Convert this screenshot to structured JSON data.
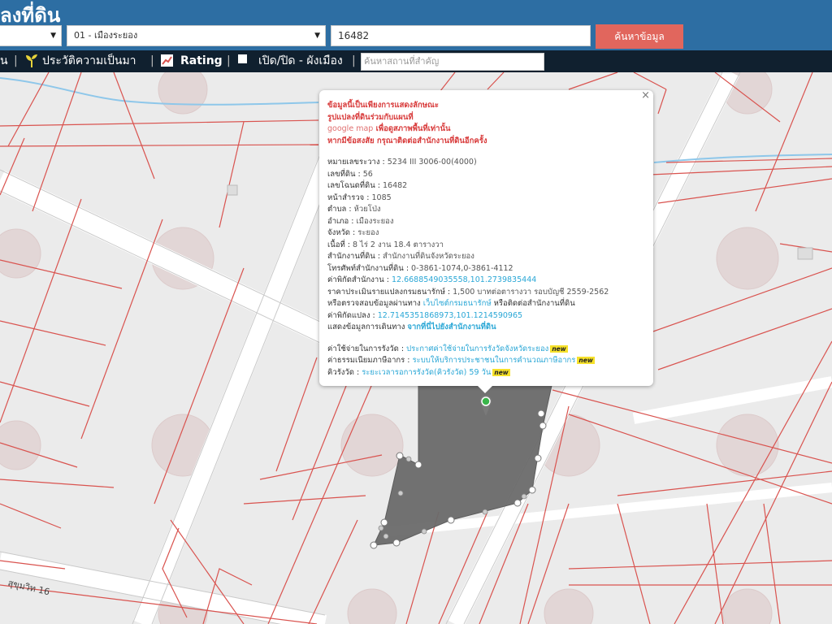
{
  "header": {
    "title": "ลงที่ดิน",
    "province_value": "",
    "district_value": "01 - เมืองระยอง",
    "deed_value": "16482",
    "search_button": "ค้นหาข้อมูล"
  },
  "toolbar": {
    "item1": "น",
    "history_label": "ประวัติความเป็นมา",
    "rating_label": "Rating",
    "toggle_label": "เปิด/ปิด - ผังเมือง",
    "place_search_placeholder": "ค้นหาสถานที่สำคัญ",
    "separator": "|"
  },
  "map": {
    "road_label": "สุขุมวิท 16",
    "parcel_color": "#6b6b6b",
    "boundary_color": "#d9534f"
  },
  "popup": {
    "close": "×",
    "disclaimer1": "ข้อมูลนี้เป็นเพียงการแสดงลักษณะ",
    "disclaimer2": "รูปแปลงที่ดินร่วมกับแผนที่",
    "disclaimer3_gm": "google map",
    "disclaimer3_rest": " เพื่อดูสภาพพื้นที่เท่านั้น",
    "disclaimer4": "หากมีข้อสงสัย กรุณาติดต่อสำนักงานที่ดินอีกครั้ง",
    "rows": [
      {
        "label": "หมายเลขระวาง",
        "value": "5234 III 3006-00(4000)"
      },
      {
        "label": "เลขที่ดิน",
        "value": "56"
      },
      {
        "label": "เลขโฉนดที่ดิน",
        "value": "16482"
      },
      {
        "label": "หน้าสำรวจ",
        "value": "1085"
      },
      {
        "label": "ตำบล",
        "value": "ห้วยโป่ง"
      },
      {
        "label": "อำเภอ",
        "value": "เมืองระยอง"
      },
      {
        "label": "จังหวัด",
        "value": "ระยอง"
      },
      {
        "label": "เนื้อที่",
        "value": "8 ไร่ 2 งาน 18.4 ตารางวา"
      },
      {
        "label": "สำนักงานที่ดิน",
        "value": "สำนักงานที่ดินจังหวัดระยอง"
      },
      {
        "label": "โทรศัพท์สำนักงานที่ดิน",
        "value": "0-3861-1074,0-3861-4112"
      }
    ],
    "office_coord_label": "ค่าพิกัดสำนักงาน",
    "office_coord_value": "12.6688549035558,101.2739835444",
    "price_label": "ราคาประเมินรายแปลงกรมธนารักษ์",
    "price_value": "1,500 บาทต่อตารางวา รอบบัญชี 2559-2562",
    "verify_text": "หรือตรวจสอบข้อมูลผ่านทาง",
    "verify_link": "เว็บไซต์กรมธนารักษ์",
    "verify_suffix": "หรือติดต่อสำนักงานที่ดิน",
    "parcel_coord_label": "ค่าพิกัดแปลง",
    "parcel_coord_value": "12.7145351868973,101.1214590965",
    "route_label": "แสดงข้อมูลการเดินทาง",
    "route_link": "จากที่นี่ไปยังสำนักงานที่ดิน",
    "fee_label": "ค่าใช้จ่ายในการรังวัด",
    "fee_link": "ประกาศค่าใช้จ่ายในการรังวัดจังหวัดระยอง",
    "tax_label": "ค่าธรรมเนียมภาษีอากร",
    "tax_link": "ระบบให้บริการประชาชนในการคำนวณภาษีอากร",
    "queue_label": "คิวรังวัด",
    "queue_link": "ระยะเวลารอการรังวัด(คิวรังวัด) 59 วัน",
    "new_badge": "new"
  }
}
